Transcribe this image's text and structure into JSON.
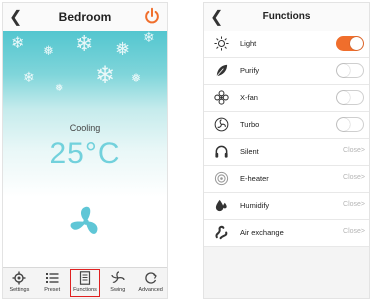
{
  "left_screen": {
    "header": {
      "back_icon": "chevron-left",
      "title": "Bedroom",
      "power_icon": "power"
    },
    "mode": "Cooling",
    "temperature": "25°C",
    "accent": "#f06e2c",
    "tabs": [
      {
        "label": "Settings",
        "icon": "gear"
      },
      {
        "label": "Preset",
        "icon": "list"
      },
      {
        "label": "Functions",
        "icon": "document",
        "active": true
      },
      {
        "label": "Swing",
        "icon": "swing"
      },
      {
        "label": "Advanced",
        "icon": "refresh"
      }
    ]
  },
  "right_screen": {
    "header": {
      "back_icon": "chevron-left",
      "title": "Functions"
    },
    "functions": [
      {
        "label": "Light",
        "icon": "sun",
        "control": "toggle",
        "state": "on"
      },
      {
        "label": "Purify",
        "icon": "leaf",
        "control": "toggle",
        "state": "off"
      },
      {
        "label": "X-fan",
        "icon": "fan",
        "control": "toggle",
        "state": "off"
      },
      {
        "label": "Turbo",
        "icon": "turbo",
        "control": "toggle",
        "state": "off"
      },
      {
        "label": "Silent",
        "icon": "headphones",
        "control": "status",
        "status": "Close>"
      },
      {
        "label": "E-heater",
        "icon": "heater",
        "control": "status",
        "status": "Close>"
      },
      {
        "label": "Humidify",
        "icon": "droplet",
        "control": "status",
        "status": "Close>"
      },
      {
        "label": "Air exchange",
        "icon": "air",
        "control": "status",
        "status": "Close>"
      }
    ]
  }
}
